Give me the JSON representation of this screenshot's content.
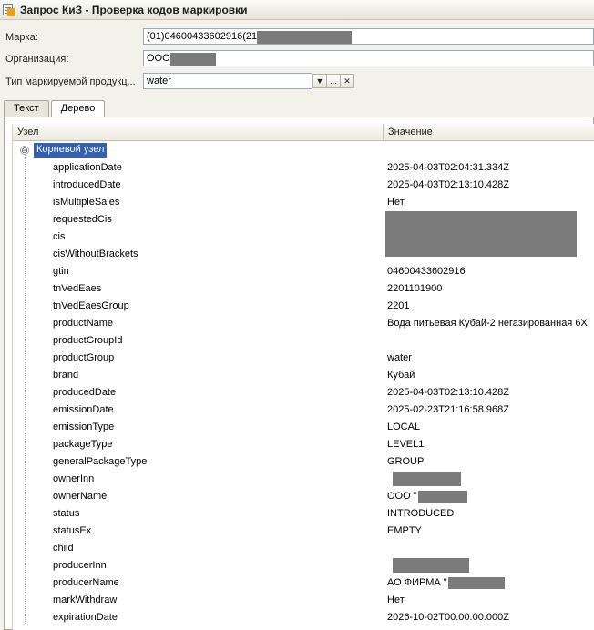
{
  "window": {
    "title": "Запрос КиЗ - Проверка кодов маркировки"
  },
  "form": {
    "marka_label": "Марка:",
    "marka_value": "(01)04600433602916(21",
    "org_label": "Организация:",
    "org_value": "ООО",
    "type_label": "Тип маркируемой продукц...",
    "type_value": "water",
    "dropdown_glyph": "▼",
    "select_glyph": "...",
    "clear_glyph": "✕"
  },
  "tabs": [
    {
      "label": "Текст"
    },
    {
      "label": "Дерево"
    }
  ],
  "grid": {
    "headers": {
      "node": "Узел",
      "value": "Значение"
    },
    "root": {
      "label": "Корневой узел",
      "toggle": "⊖"
    },
    "rows": [
      {
        "name": "applicationDate",
        "value": "2025-04-03T02:04:31.334Z"
      },
      {
        "name": "introducedDate",
        "value": "2025-04-03T02:13:10.428Z"
      },
      {
        "name": "isMultipleSales",
        "value": "Нет"
      },
      {
        "name": "requestedCis",
        "value": ""
      },
      {
        "name": "cis",
        "value": ""
      },
      {
        "name": "cisWithoutBrackets",
        "value": ""
      },
      {
        "name": "gtin",
        "value": "04600433602916"
      },
      {
        "name": "tnVedEaes",
        "value": "2201101900"
      },
      {
        "name": "tnVedEaesGroup",
        "value": "2201"
      },
      {
        "name": "productName",
        "value": "Вода питьевая Кубай-2 негазированная 6Х"
      },
      {
        "name": "productGroupId",
        "value": ""
      },
      {
        "name": "productGroup",
        "value": "water"
      },
      {
        "name": "brand",
        "value": "Кубай"
      },
      {
        "name": "producedDate",
        "value": "2025-04-03T02:13:10.428Z"
      },
      {
        "name": "emissionDate",
        "value": "2025-02-23T21:16:58.968Z"
      },
      {
        "name": "emissionType",
        "value": "LOCAL"
      },
      {
        "name": "packageType",
        "value": "LEVEL1"
      },
      {
        "name": "generalPackageType",
        "value": "GROUP"
      },
      {
        "name": "ownerInn",
        "value": ""
      },
      {
        "name": "ownerName",
        "value": "ООО \"",
        "suffix": "\""
      },
      {
        "name": "status",
        "value": "INTRODUCED"
      },
      {
        "name": "statusEx",
        "value": "EMPTY"
      },
      {
        "name": "child",
        "value": ""
      },
      {
        "name": "producerInn",
        "value": ""
      },
      {
        "name": "producerName",
        "value": "АО ФИРМА \"",
        "suffix": "\""
      },
      {
        "name": "markWithdraw",
        "value": "Нет"
      },
      {
        "name": "expirationDate",
        "value": "2026-10-02T00:00:00.000Z"
      }
    ]
  },
  "colors": {
    "selection": "#3260b6",
    "redaction": "#7b7b7b",
    "field_border": "#9aa7bd"
  }
}
